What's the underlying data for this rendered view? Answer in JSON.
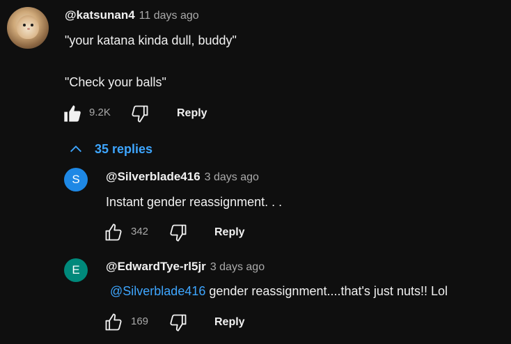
{
  "comment": {
    "author": "@katsunan4",
    "time": "11 days ago",
    "line1": "\"your katana kinda dull, buddy\"",
    "line2": "\"Check your balls\"",
    "likes": "9.2K",
    "reply_label": "Reply",
    "avatar_icon": "hamster-avatar"
  },
  "replies_toggle": {
    "label": "35 replies",
    "icon": "chevron-up-icon"
  },
  "replies": [
    {
      "avatar_letter": "S",
      "avatar_color": "#1e88e5",
      "author": "@Silverblade416",
      "time": "3 days ago",
      "text": "Instant gender reassignment. . .",
      "likes": "342",
      "reply_label": "Reply"
    },
    {
      "avatar_letter": "E",
      "avatar_color": "#00897b",
      "author": "@EdwardTye-rl5jr",
      "time": "3 days ago",
      "mention": "@Silverblade416",
      "text": " gender reassignment....that's just nuts!! Lol",
      "likes": "169",
      "reply_label": "Reply"
    }
  ],
  "colors": {
    "background": "#0f0f0f",
    "link": "#3ea6ff",
    "secondary_text": "#aaaaaa"
  }
}
